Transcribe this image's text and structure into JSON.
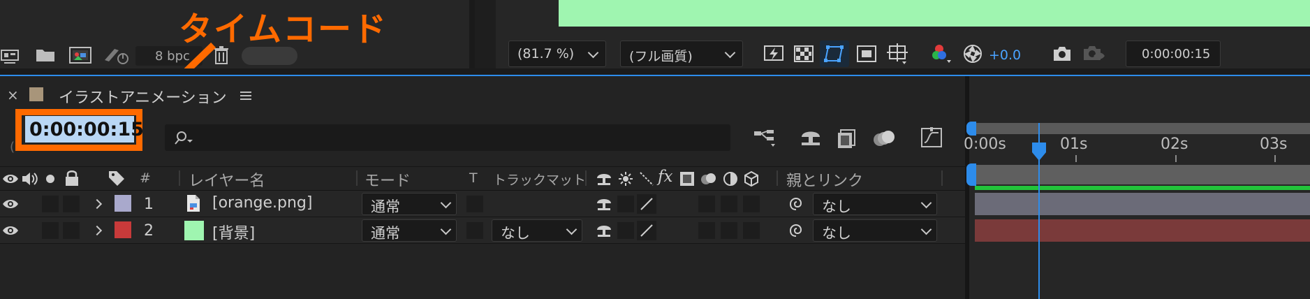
{
  "annotation": {
    "callout_label": "タイムコード",
    "color": "#ff6a00"
  },
  "project_panel": {
    "bit_depth": "8 bpc"
  },
  "viewer": {
    "zoom": "(81.7 %)",
    "resolution": "(フル画質)",
    "exposure": "+0.0",
    "current_time": "0:00:00:15"
  },
  "composition": {
    "name": "イラストアニメーション",
    "timecode": "0:00:00:15"
  },
  "columns": {
    "hash": "#",
    "layer_name": "レイヤー名",
    "mode": "モード",
    "t": "T",
    "track_matte": "トラックマット",
    "fx": "fx",
    "parent_link": "親とリンク"
  },
  "layers": [
    {
      "number": "1",
      "name": "[orange.png]",
      "mode": "通常",
      "track_matte": "",
      "parent": "なし",
      "label_color": "#a9a9cc",
      "bar_color": "#6b6b78"
    },
    {
      "number": "2",
      "name": "[背景]",
      "mode": "通常",
      "track_matte": "なし",
      "parent": "なし",
      "label_color": "#c83a3a",
      "bar_color": "#7a3a3a"
    }
  ],
  "ruler": {
    "ticks": [
      "0:00s",
      "01s",
      "02s",
      "03s"
    ]
  },
  "colors": {
    "accent_blue": "#2d8ceb",
    "work_area_green": "#22c43a",
    "canvas_green": "#9ff5b0"
  }
}
